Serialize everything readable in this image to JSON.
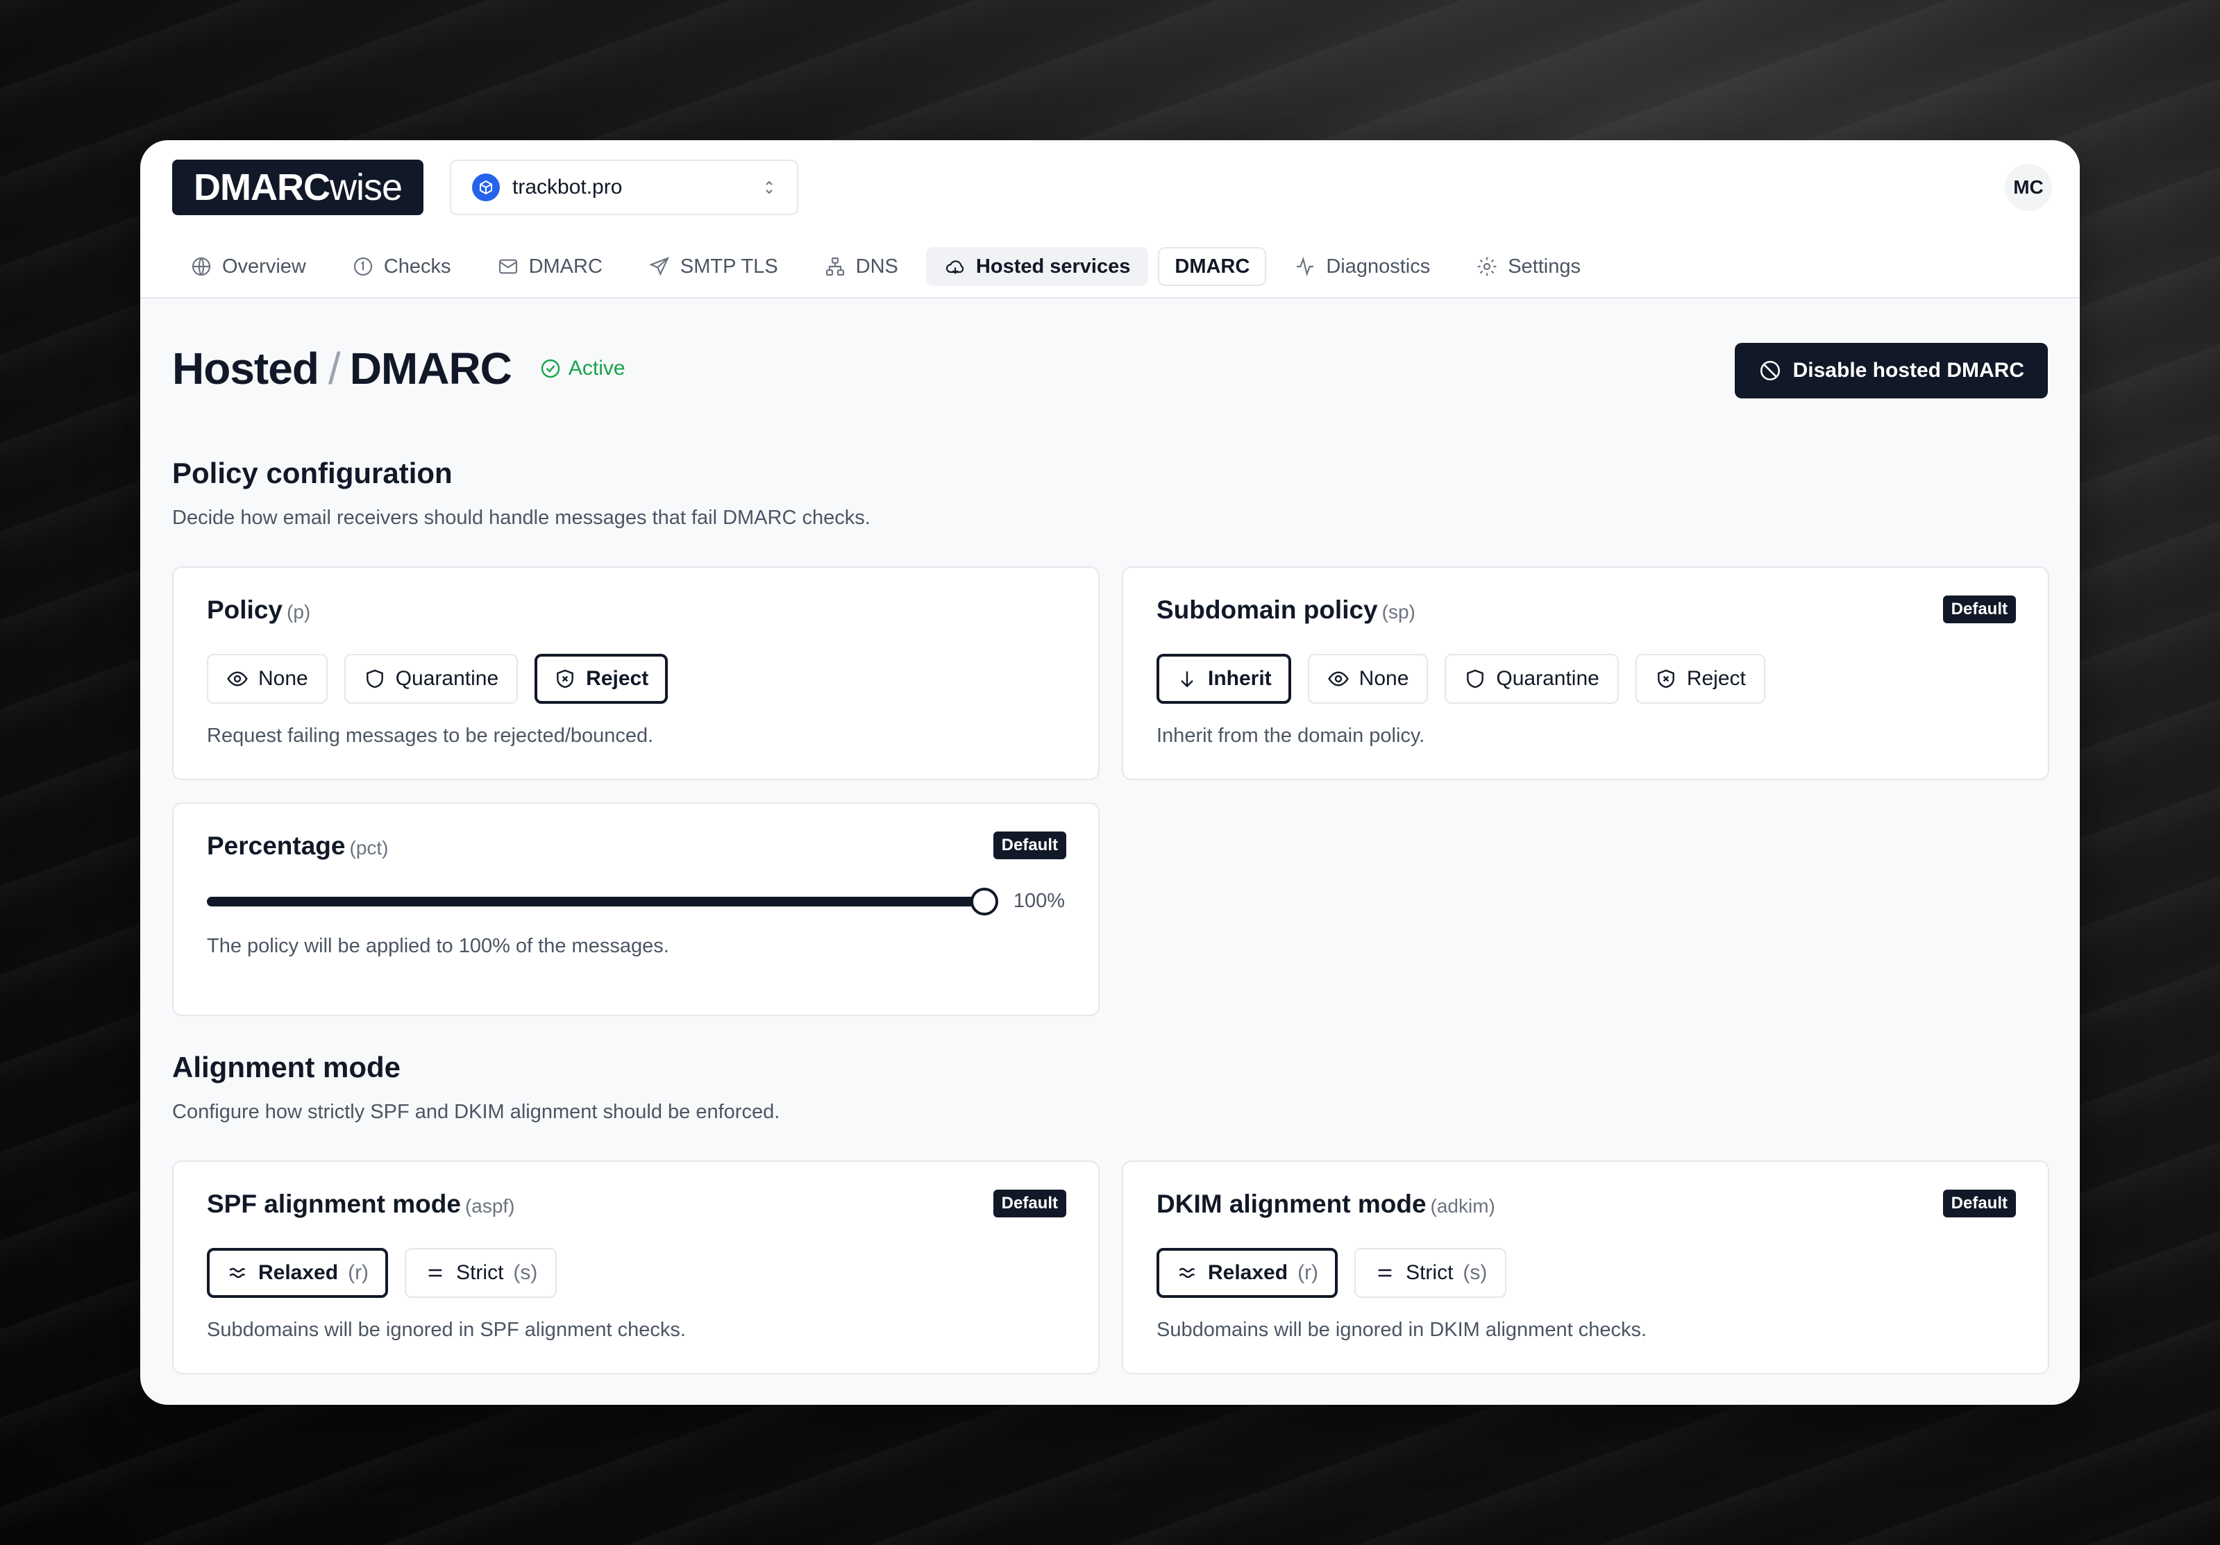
{
  "app": {
    "logo_bold": "DMARC",
    "logo_light": "wise",
    "user_initials": "MC"
  },
  "domain_selector": {
    "value": "trackbot.pro"
  },
  "nav": {
    "items": [
      {
        "label": "Overview",
        "icon": "globe-icon"
      },
      {
        "label": "Checks",
        "icon": "circle-1-icon"
      },
      {
        "label": "DMARC",
        "icon": "mail-icon"
      },
      {
        "label": "SMTP TLS",
        "icon": "send-icon"
      },
      {
        "label": "DNS",
        "icon": "network-icon"
      },
      {
        "label": "Hosted services",
        "icon": "cloud-icon"
      },
      {
        "label": "DMARC",
        "icon": ""
      },
      {
        "label": "Diagnostics",
        "icon": "activity-icon"
      },
      {
        "label": "Settings",
        "icon": "gear-icon"
      }
    ]
  },
  "page": {
    "title_part1": "Hosted",
    "title_sep": "/",
    "title_part2": "DMARC",
    "status": "Active",
    "disable_label": "Disable hosted DMARC"
  },
  "policy_section": {
    "title": "Policy configuration",
    "description": "Decide how email receivers should handle messages that fail DMARC checks."
  },
  "policy_card": {
    "title": "Policy",
    "code": "(p)",
    "options": [
      "None",
      "Quarantine",
      "Reject"
    ],
    "selected": "Reject",
    "description": "Request failing messages to be rejected/bounced."
  },
  "subdomain_card": {
    "title": "Subdomain policy",
    "code": "(sp)",
    "badge": "Default",
    "options": [
      "Inherit",
      "None",
      "Quarantine",
      "Reject"
    ],
    "selected": "Inherit",
    "description": "Inherit from the domain policy."
  },
  "percentage_card": {
    "title": "Percentage",
    "code": "(pct)",
    "badge": "Default",
    "value": 100,
    "value_label": "100%",
    "description": "The policy will be applied to 100% of the messages."
  },
  "alignment_section": {
    "title": "Alignment mode",
    "description": "Configure how strictly SPF and DKIM alignment should be enforced."
  },
  "spf_card": {
    "title": "SPF alignment mode",
    "code": "(aspf)",
    "badge": "Default",
    "relaxed_label": "Relaxed",
    "relaxed_code": "(r)",
    "strict_label": "Strict",
    "strict_code": "(s)",
    "selected": "Relaxed",
    "description": "Subdomains will be ignored in SPF alignment checks."
  },
  "dkim_card": {
    "title": "DKIM alignment mode",
    "code": "(adkim)",
    "badge": "Default",
    "relaxed_label": "Relaxed",
    "relaxed_code": "(r)",
    "strict_label": "Strict",
    "strict_code": "(s)",
    "selected": "Relaxed",
    "description": "Subdomains will be ignored in DKIM alignment checks."
  },
  "colors": {
    "accent": "#111827",
    "active": "#16a34a",
    "domain_icon": "#2563eb"
  }
}
